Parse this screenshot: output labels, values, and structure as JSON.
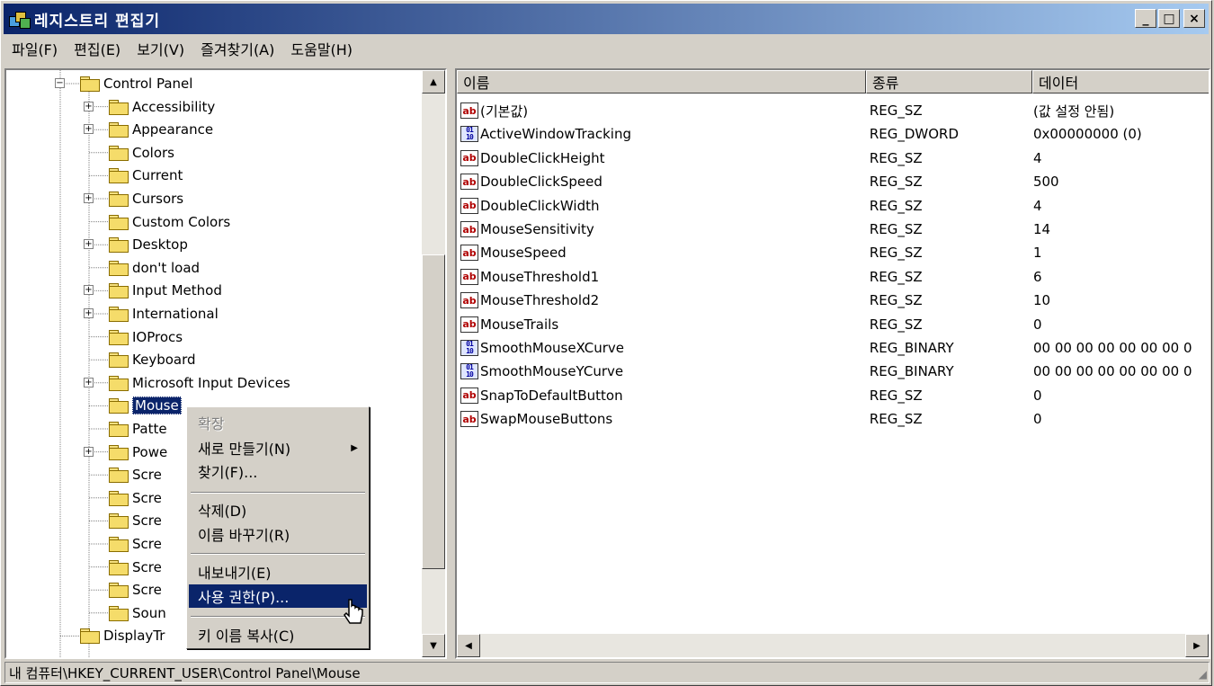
{
  "window": {
    "title": "레지스트리 편집기",
    "buttons": {
      "minimize": "_",
      "maximize": "□",
      "close": "×"
    }
  },
  "menubar": [
    "파일(F)",
    "편집(E)",
    "보기(V)",
    "즐겨찾기(A)",
    "도움말(H)"
  ],
  "tree": {
    "items": [
      {
        "label": "Control Panel",
        "expander": "−"
      },
      {
        "label": "Accessibility",
        "expander": "+"
      },
      {
        "label": "Appearance",
        "expander": "+"
      },
      {
        "label": "Colors",
        "expander": ""
      },
      {
        "label": "Current",
        "expander": ""
      },
      {
        "label": "Cursors",
        "expander": "+"
      },
      {
        "label": "Custom Colors",
        "expander": ""
      },
      {
        "label": "Desktop",
        "expander": "+"
      },
      {
        "label": "don't load",
        "expander": ""
      },
      {
        "label": "Input Method",
        "expander": "+"
      },
      {
        "label": "International",
        "expander": "+"
      },
      {
        "label": "IOProcs",
        "expander": ""
      },
      {
        "label": "Keyboard",
        "expander": ""
      },
      {
        "label": "Microsoft Input Devices",
        "expander": "+"
      },
      {
        "label": "Mouse",
        "expander": "",
        "selected": true
      },
      {
        "label": "Patte",
        "expander": ""
      },
      {
        "label": "Powe",
        "expander": "+"
      },
      {
        "label": "Scre",
        "expander": ""
      },
      {
        "label": "Scre",
        "expander": ""
      },
      {
        "label": "Scre",
        "expander": ""
      },
      {
        "label": "Scre",
        "expander": ""
      },
      {
        "label": "Scre",
        "expander": ""
      },
      {
        "label": "Scre",
        "expander": ""
      },
      {
        "label": "Soun",
        "expander": ""
      },
      {
        "label": "DisplayTr",
        "expander": ""
      }
    ]
  },
  "list": {
    "columns": [
      "이름",
      "종류",
      "데이터"
    ],
    "rows": [
      {
        "icon": "ab",
        "name": "(기본값)",
        "type": "REG_SZ",
        "data": "(값 설정 안됨)"
      },
      {
        "icon": "bin",
        "name": "ActiveWindowTracking",
        "type": "REG_DWORD",
        "data": "0x00000000 (0)"
      },
      {
        "icon": "ab",
        "name": "DoubleClickHeight",
        "type": "REG_SZ",
        "data": "4"
      },
      {
        "icon": "ab",
        "name": "DoubleClickSpeed",
        "type": "REG_SZ",
        "data": "500"
      },
      {
        "icon": "ab",
        "name": "DoubleClickWidth",
        "type": "REG_SZ",
        "data": "4"
      },
      {
        "icon": "ab",
        "name": "MouseSensitivity",
        "type": "REG_SZ",
        "data": "14"
      },
      {
        "icon": "ab",
        "name": "MouseSpeed",
        "type": "REG_SZ",
        "data": "1"
      },
      {
        "icon": "ab",
        "name": "MouseThreshold1",
        "type": "REG_SZ",
        "data": "6"
      },
      {
        "icon": "ab",
        "name": "MouseThreshold2",
        "type": "REG_SZ",
        "data": "10"
      },
      {
        "icon": "ab",
        "name": "MouseTrails",
        "type": "REG_SZ",
        "data": "0"
      },
      {
        "icon": "bin",
        "name": "SmoothMouseXCurve",
        "type": "REG_BINARY",
        "data": "00 00 00 00 00 00 00 0"
      },
      {
        "icon": "bin",
        "name": "SmoothMouseYCurve",
        "type": "REG_BINARY",
        "data": "00 00 00 00 00 00 00 0"
      },
      {
        "icon": "ab",
        "name": "SnapToDefaultButton",
        "type": "REG_SZ",
        "data": "0"
      },
      {
        "icon": "ab",
        "name": "SwapMouseButtons",
        "type": "REG_SZ",
        "data": "0"
      }
    ]
  },
  "context_menu": {
    "items": [
      {
        "label": "확장",
        "disabled": true
      },
      {
        "label": "새로 만들기(N)",
        "submenu": true
      },
      {
        "label": "찾기(F)..."
      },
      {
        "label": "삭제(D)"
      },
      {
        "label": "이름 바꾸기(R)"
      },
      {
        "label": "내보내기(E)"
      },
      {
        "label": "사용 권한(P)...",
        "highlighted": true
      },
      {
        "label": "키 이름 복사(C)"
      }
    ]
  },
  "statusbar": {
    "path": "내 컴퓨터\\HKEY_CURRENT_USER\\Control Panel\\Mouse"
  },
  "colors": {
    "titlebar": "#0a246a",
    "selection": "#0a246a",
    "face": "#d4d0c8"
  }
}
